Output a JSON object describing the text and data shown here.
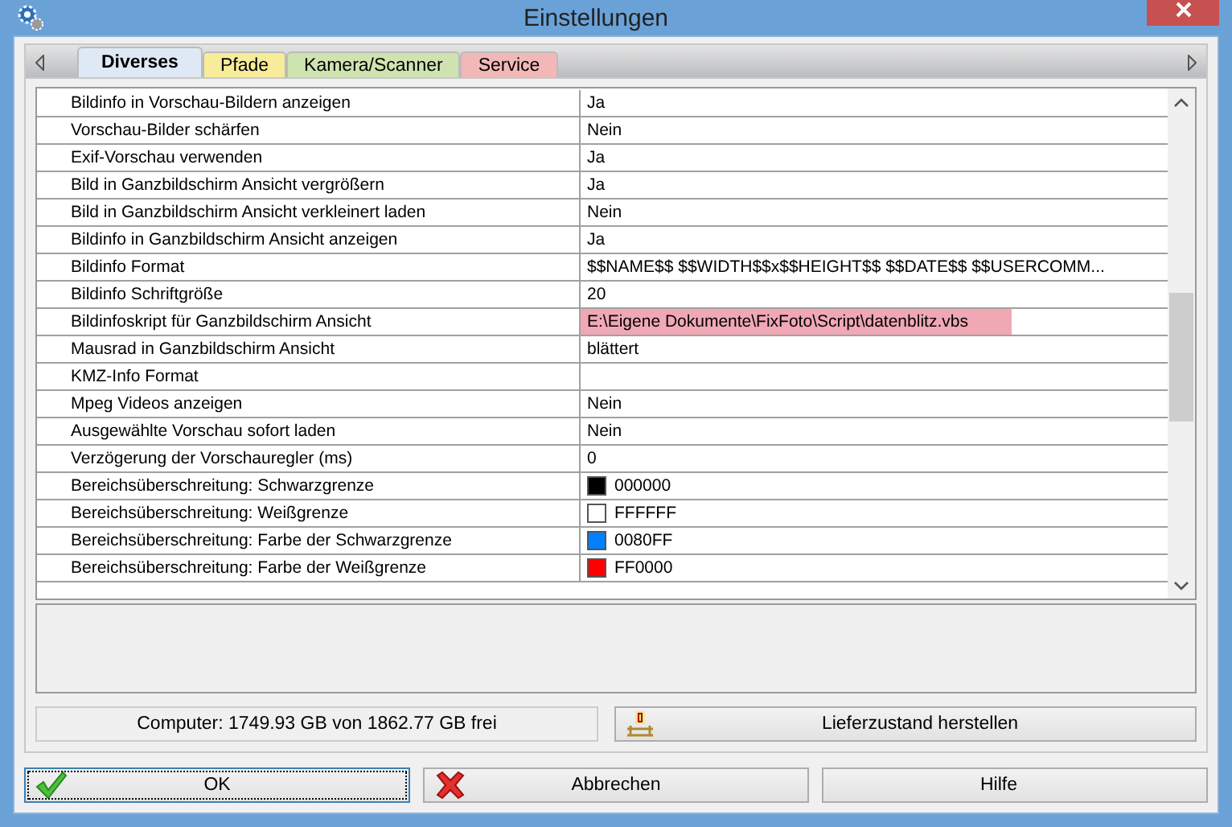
{
  "window": {
    "title": "Einstellungen"
  },
  "tabs": [
    {
      "label": "Diverses",
      "selected": true,
      "color": "#dfe9f5"
    },
    {
      "label": "Pfade",
      "selected": false,
      "color": "#f7ec9a"
    },
    {
      "label": "Kamera/Scanner",
      "selected": false,
      "color": "#cfe3b0"
    },
    {
      "label": "Service",
      "selected": false,
      "color": "#f2b8b8"
    }
  ],
  "settings": [
    {
      "kind": "text",
      "label": "Bildinfo in Vorschau-Bildern anzeigen",
      "value": "Ja",
      "selected": false
    },
    {
      "kind": "text",
      "label": "Vorschau-Bilder schärfen",
      "value": "Nein",
      "selected": false
    },
    {
      "kind": "text",
      "label": "Exif-Vorschau verwenden",
      "value": "Ja",
      "selected": false
    },
    {
      "kind": "text",
      "label": "Bild in Ganzbildschirm Ansicht vergrößern",
      "value": "Ja",
      "selected": false
    },
    {
      "kind": "text",
      "label": "Bild in Ganzbildschirm Ansicht verkleinert laden",
      "value": "Nein",
      "selected": false
    },
    {
      "kind": "text",
      "label": "Bildinfo in Ganzbildschirm Ansicht anzeigen",
      "value": "Ja",
      "selected": false
    },
    {
      "kind": "text",
      "label": "Bildinfo Format",
      "value": "$$NAME$$ $$WIDTH$$x$$HEIGHT$$ $$DATE$$ $$USERCOMM...",
      "selected": false
    },
    {
      "kind": "text",
      "label": "Bildinfo Schriftgröße",
      "value": "20",
      "selected": false
    },
    {
      "kind": "text",
      "label": "Bildinfoskript für Ganzbildschirm Ansicht",
      "value": "E:\\Eigene Dokumente\\FixFoto\\Script\\datenblitz.vbs",
      "selected": true
    },
    {
      "kind": "text",
      "label": "Mausrad in Ganzbildschirm Ansicht",
      "value": "blättert",
      "selected": false
    },
    {
      "kind": "text",
      "label": "KMZ-Info Format",
      "selected": false
    },
    {
      "kind": "text",
      "label": "Mpeg Videos anzeigen",
      "value": "Nein",
      "selected": false
    },
    {
      "kind": "text",
      "label": "Ausgewählte Vorschau sofort laden",
      "value": "Nein",
      "selected": false
    },
    {
      "kind": "text",
      "label": "Verzögerung der Vorschauregler (ms)",
      "value": "0",
      "selected": false
    },
    {
      "kind": "color",
      "label": "Bereichsüberschreitung: Schwarzgrenze",
      "value": "000000",
      "color": "#000000",
      "selected": false
    },
    {
      "kind": "color",
      "label": "Bereichsüberschreitung: Weißgrenze",
      "value": "FFFFFF",
      "color": "#ffffff",
      "selected": false
    },
    {
      "kind": "color",
      "label": "Bereichsüberschreitung: Farbe der Schwarzgrenze",
      "value": "0080FF",
      "color": "#0080ff",
      "selected": false
    },
    {
      "kind": "color",
      "label": "Bereichsüberschreitung: Farbe der Weißgrenze",
      "value": "FF0000",
      "color": "#ff0000",
      "selected": false
    }
  ],
  "status": {
    "text": "Computer: 1749.93 GB von 1862.77 GB frei"
  },
  "reset_button": {
    "label": "Lieferzustand herstellen"
  },
  "buttons": [
    {
      "kind": "ok",
      "label": "OK",
      "focused": true
    },
    {
      "kind": "cancel",
      "label": "Abbrechen",
      "focused": false
    },
    {
      "kind": "help",
      "label": "Hilfe",
      "focused": false
    }
  ]
}
